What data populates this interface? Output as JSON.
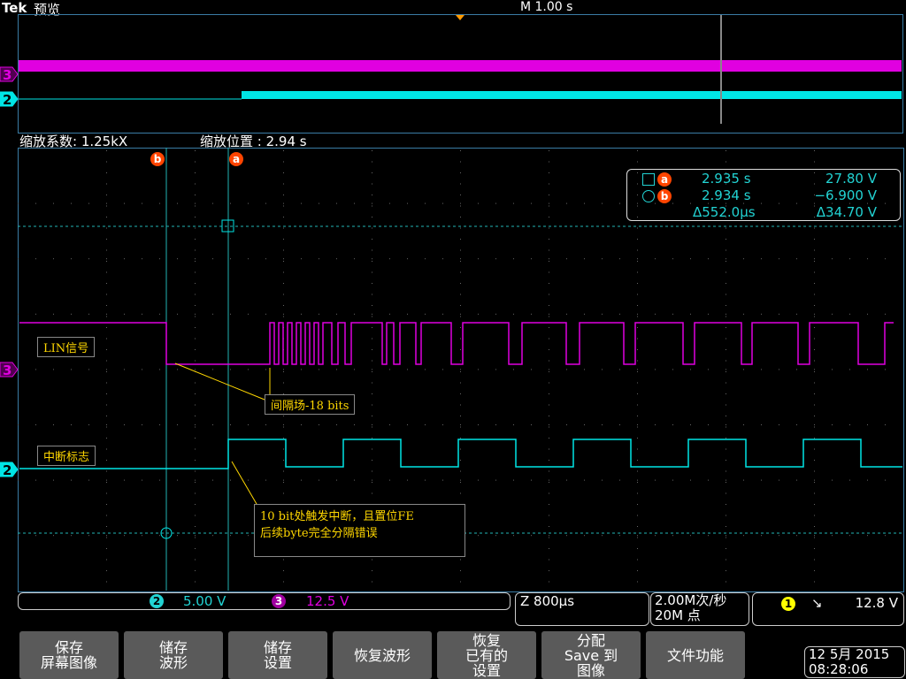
{
  "header": {
    "brand": "Tek",
    "title": "预览",
    "timebase": "M 1.00 s"
  },
  "zoom": {
    "factor": "缩放系数: 1.25kX",
    "position": "缩放位置 :  2.94 s"
  },
  "cursors": {
    "a_label": "a",
    "b_label": "b",
    "a_time": "2.935 s",
    "a_volt": "27.80 V",
    "b_time": "2.934 s",
    "b_volt": "−6.900 V",
    "delta_time": "Δ552.0µs",
    "delta_volt": "Δ34.70 V"
  },
  "annotations": {
    "lin": "LIN信号",
    "interrupt": "中断标志",
    "gap": "间隔场-18 bits",
    "note1": "10 bit处触发中断，且置位FE",
    "note2": "后续byte完全分隔错误"
  },
  "channels": [
    {
      "num": "2",
      "scale": "5.00 V",
      "color": "#00e5e5"
    },
    {
      "num": "3",
      "scale": "12.5 V",
      "color": "#e000e0"
    }
  ],
  "horizontal": {
    "scale": "Z 800µs"
  },
  "acquisition": {
    "rate": "2.00M次/秒",
    "points": "20M 点"
  },
  "trigger": {
    "source": "1",
    "slope": "↘",
    "level": "12.8 V"
  },
  "menu": [
    "保存\n屏幕图像",
    "储存\n波形",
    "储存\n设置",
    "恢复波形",
    "恢复\n已有的\n设置",
    "分配\nSave 到\n图像",
    "文件功能"
  ],
  "datetime": {
    "date": "12 5月  2015",
    "time": "08:28:06"
  }
}
